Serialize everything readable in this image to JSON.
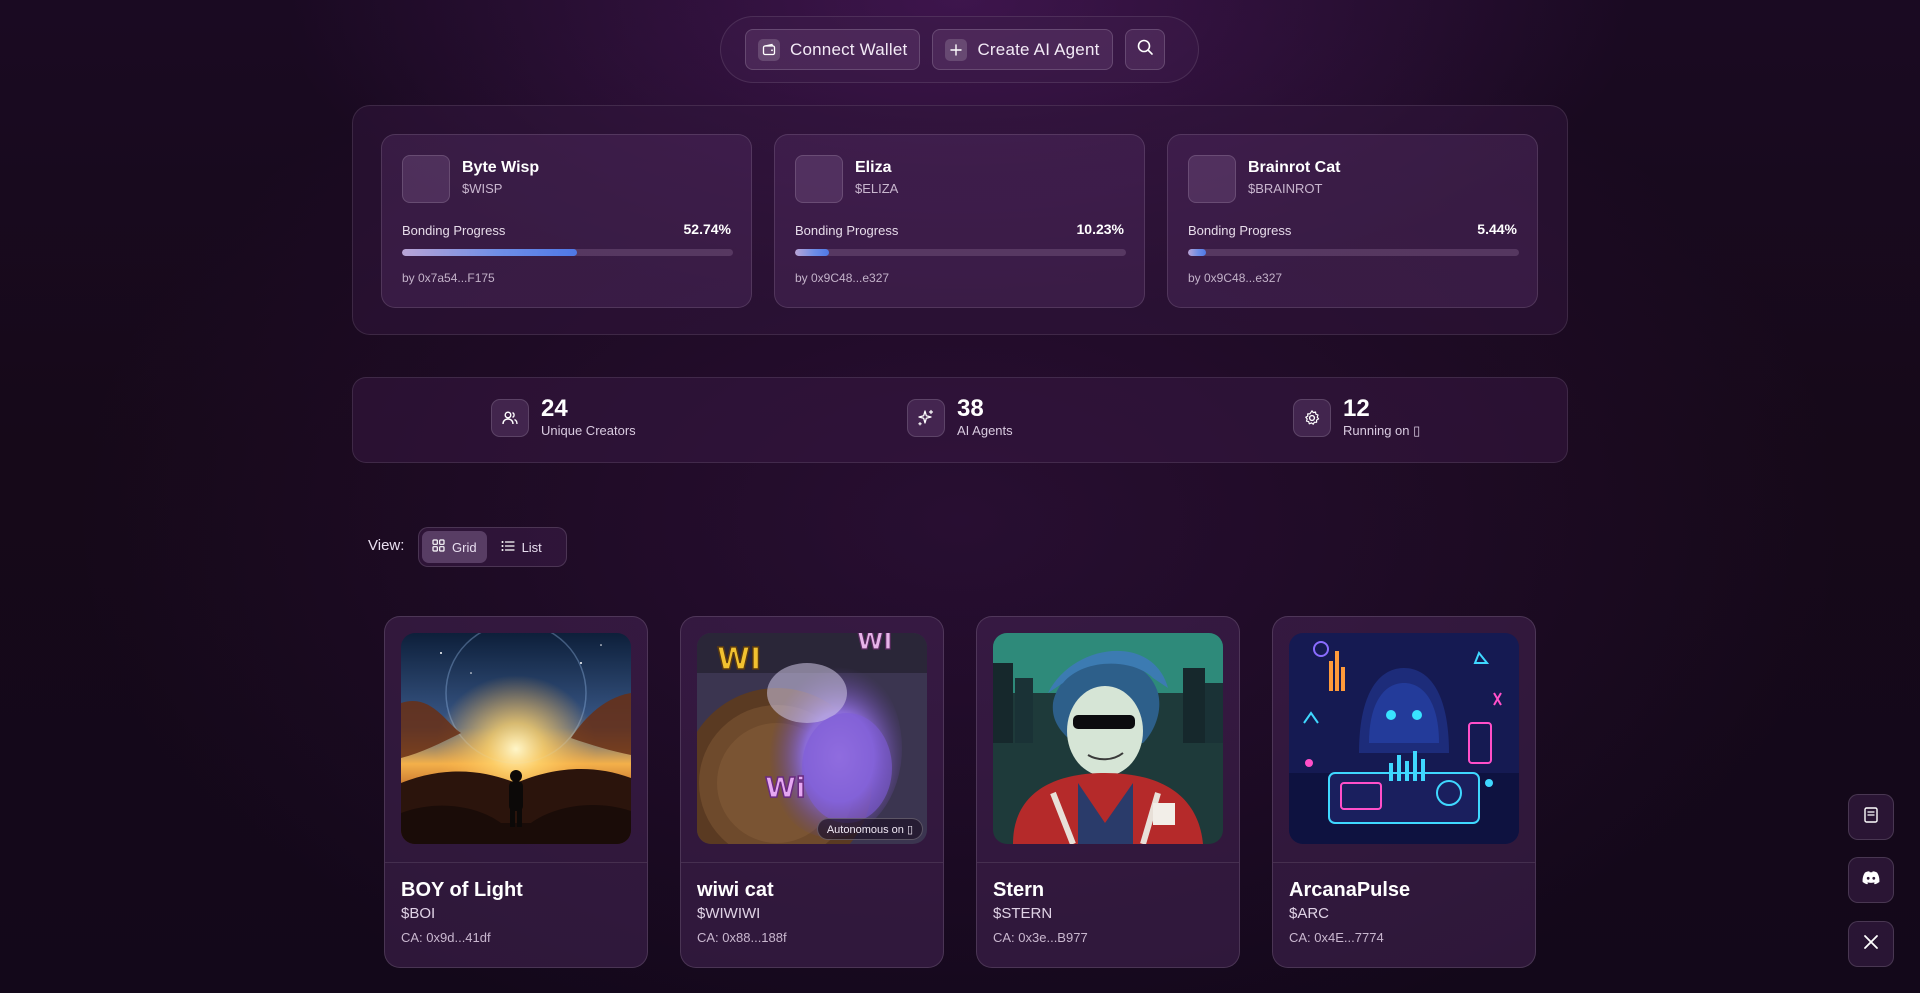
{
  "nav": {
    "connect_wallet": "Connect Wallet",
    "create_agent": "Create AI Agent",
    "search_icon": "search-icon"
  },
  "trending": [
    {
      "name": "Byte Wisp",
      "ticker": "$WISP",
      "progress_label": "Bonding Progress",
      "progress_text": "52.74%",
      "progress": 0.5274,
      "creator": "by 0x7a54...F175"
    },
    {
      "name": "Eliza",
      "ticker": "$ELIZA",
      "progress_label": "Bonding Progress",
      "progress_text": "10.23%",
      "progress": 0.1023,
      "creator": "by 0x9C48...e327"
    },
    {
      "name": "Brainrot Cat",
      "ticker": "$BRAINROT",
      "progress_label": "Bonding Progress",
      "progress_text": "5.44%",
      "progress": 0.0544,
      "creator": "by 0x9C48...e327"
    }
  ],
  "stats": [
    {
      "value": "24",
      "label": "Unique Creators",
      "icon": "users-icon"
    },
    {
      "value": "38",
      "label": "AI Agents",
      "icon": "sparkles-icon"
    },
    {
      "value": "12",
      "label": "Running on ▯",
      "icon": "gear-icon"
    }
  ],
  "view": {
    "label": "View:",
    "grid": "Grid",
    "list": "List",
    "selected": "Grid"
  },
  "agents": [
    {
      "name": "BOY of Light",
      "ticker": "$BOI",
      "ca": "CA: 0x9d...41df"
    },
    {
      "name": "wiwi cat",
      "ticker": "$WIWIWI",
      "ca": "CA: 0x88...188f",
      "badge": "Autonomous on ▯",
      "image_texts": [
        "WI",
        "WI",
        "Wi"
      ]
    },
    {
      "name": "Stern",
      "ticker": "$STERN",
      "ca": "CA: 0x3e...B977"
    },
    {
      "name": "ArcanaPulse",
      "ticker": "$ARC",
      "ca": "CA: 0x4E...7774"
    }
  ],
  "side_buttons": [
    "docs-icon",
    "discord-icon",
    "x-icon"
  ],
  "colors": {
    "background": "#160919",
    "progress_start": "#b9a4d6",
    "progress_end": "#4f78e6"
  }
}
